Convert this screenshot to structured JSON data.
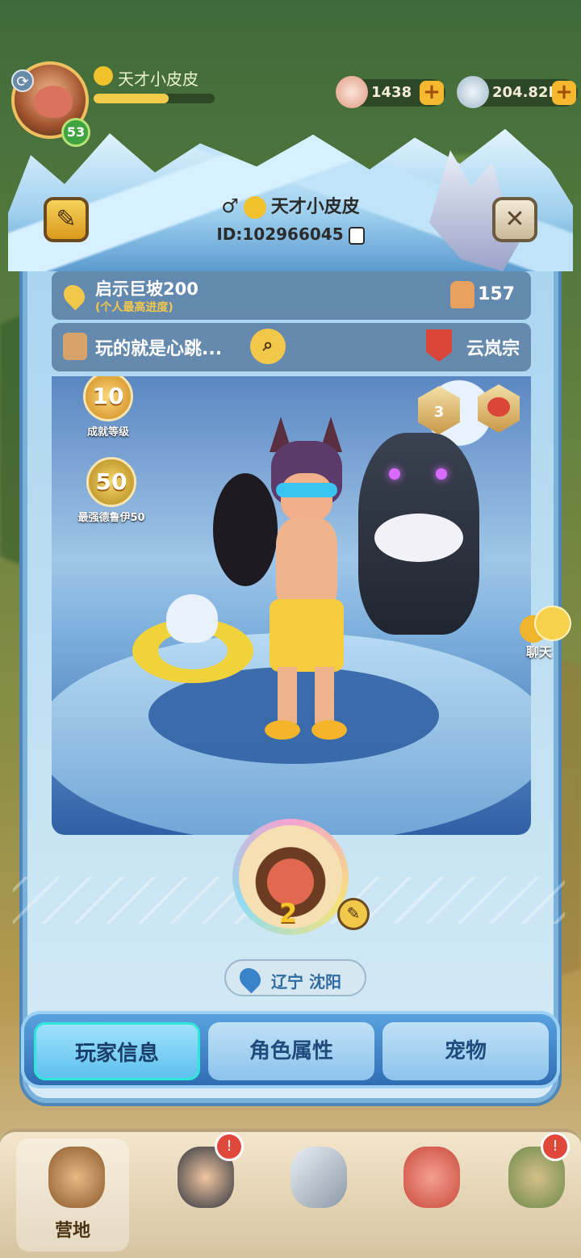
{
  "hud": {
    "player_name": "天才小皮皮",
    "level": "53",
    "xp_fraction": 0.62,
    "shells": "1438",
    "stones": "204.82M",
    "plus": "+"
  },
  "profile": {
    "gender_symbol": "♂",
    "name": "天才小皮皮",
    "id_label": "ID:102966045",
    "progress_title": "启示巨坡200",
    "progress_sub": "(个人最高进度)",
    "strength": "157",
    "signature": "玩的就是心跳...",
    "clan": "云岚宗",
    "achievement_level": "10",
    "achievement_label": "成就等级",
    "druid_level": "50",
    "druid_label": "最强德鲁伊50",
    "map_badge_level": "3",
    "close_symbol": "✕"
  },
  "chat": {
    "label": "聊天"
  },
  "pet": {
    "level": "2"
  },
  "location": {
    "text": "辽宁 沈阳"
  },
  "tabs": [
    {
      "label": "玩家信息",
      "active": true
    },
    {
      "label": "角色属性",
      "active": false
    },
    {
      "label": "宠物",
      "active": false
    }
  ],
  "bottom_nav": {
    "camp_label": "营地"
  },
  "icons": {
    "search": "search-icon",
    "bell": "bell-icon",
    "edit": "pencil-icon"
  }
}
